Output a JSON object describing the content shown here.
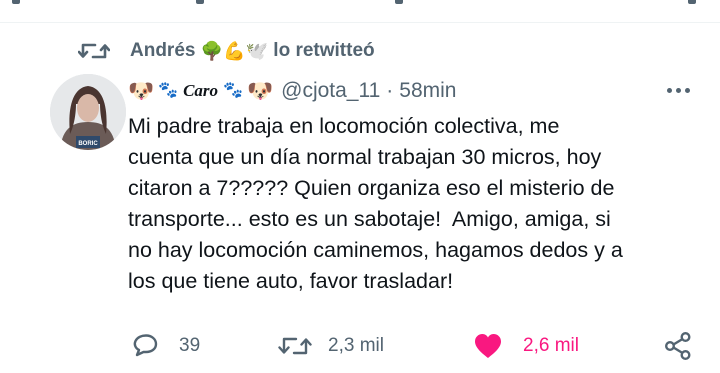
{
  "retweet": {
    "user": "Andrés",
    "suffix": "lo retwitteó",
    "emojis": [
      "🌳",
      "💪",
      "🕊️"
    ]
  },
  "tweet": {
    "display_name_decorations": [
      "🐶",
      "🐾",
      "Caro",
      "🐾",
      "🐶"
    ],
    "handle": "@cjota_11",
    "separator": "·",
    "time": "58min",
    "text": "Mi padre trabaja en locomoción colectiva, me\ncuenta que un día normal trabajan 30 micros, hoy\ncitaron a 7????? Quien organiza eso el misterio de\ntransporte... esto es un sabotaje!  Amigo, amiga, si\nno hay locomoción caminemos, hagamos dedos y a\nlos que tiene auto, favor trasladar!",
    "avatar_badge": "BORIC"
  },
  "actions": {
    "reply_count": "39",
    "retweet_count": "2,3 mil",
    "like_count": "2,6 mil"
  },
  "colors": {
    "secondary_text": "#536471",
    "like_pink": "#f91880",
    "text": "#0f1419"
  },
  "icons": [
    "retweet-icon",
    "more-icon",
    "reply-icon",
    "heart-icon",
    "share-icon"
  ]
}
